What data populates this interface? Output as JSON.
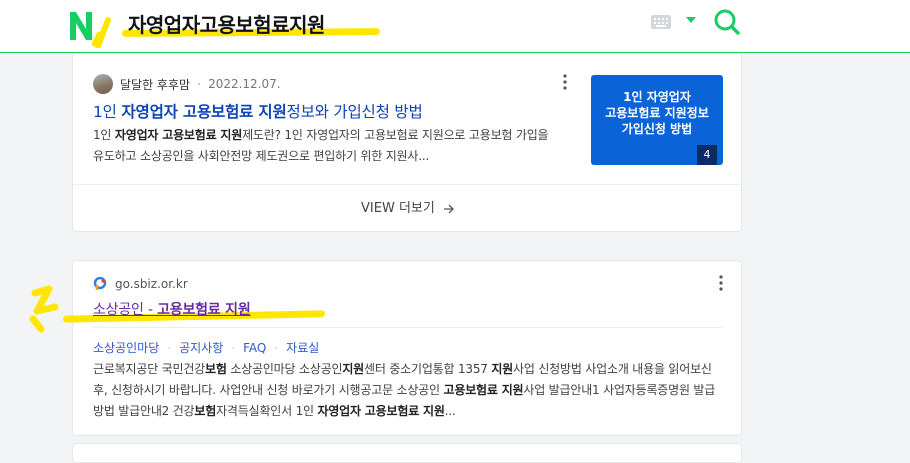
{
  "header": {
    "query": "자영업자고용보험료지원",
    "logo": "N",
    "icons": [
      "naver-logo",
      "keyboard-icon",
      "caret-down-icon",
      "search-icon"
    ],
    "colors": {
      "brand": "#19ce60",
      "highlight": "#ffe600"
    }
  },
  "result1": {
    "author": "달달한 후후맘",
    "date": "2022.12.07.",
    "title": {
      "pre": "1인 ",
      "bold": "자영업자 고용보험료 지원",
      "post": "정보와 가입신청 방법"
    },
    "desc": {
      "p1": "1인 ",
      "b1": "자영업자 고용보험료 지원",
      "p2": "제도란? 1인 자영업자의 고용보험료 지원으로 고용보험 가입을 유도하고 소상공인을 사회안전망 제도권으로 편입하기 위한 지원사..."
    },
    "thumbnail": {
      "text": "1인 자영업자\n고용보험료 지원정보\n가입신청 방법",
      "count": "4"
    },
    "view_more": "VIEW 더보기"
  },
  "result2": {
    "site": "go.sbiz.or.kr",
    "title": {
      "pre": "소상공인 - ",
      "bold": "고용보험료 지원"
    },
    "sitelinks": [
      "소상공인마당",
      "공지사항",
      "FAQ",
      "자료실"
    ],
    "desc": {
      "p1": "근로복지공단 국민건강",
      "b1": "보험",
      "p2": " 소상공인마당 소상공인",
      "b2": "지원",
      "p3": "센터 중소기업통합 1357 ",
      "b3": "지원",
      "p4": "사업 신청방법 사업소개 내용을 읽어보신 후, 신청하시기 바랍니다. 사업안내 신청 바로가기 시행공고문 소상공인 ",
      "b4": "고용보험료 지원",
      "p5": "사업 발급안내1 사업자등록증명원 발급 방법 발급안내2 건강",
      "b5": "보험",
      "p6": "자격득실확인서 1인 ",
      "b6": "자영업자 고용보험료 지원",
      "p7": "..."
    }
  }
}
